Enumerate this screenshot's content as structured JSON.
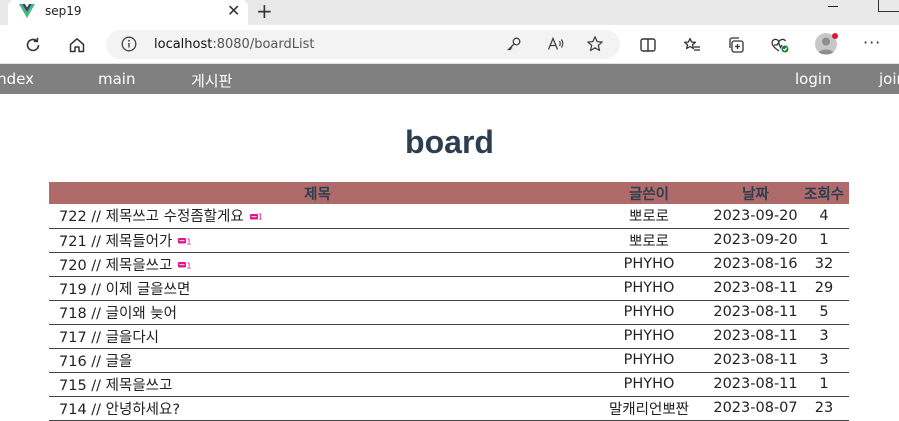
{
  "browser": {
    "tab_title": "sep19",
    "url_host": "localhost",
    "url_rest": ":8080/boardList",
    "accent": "#42b883"
  },
  "nav": {
    "index": "index",
    "main": "main",
    "board": "게시판",
    "login": "login",
    "join": "join"
  },
  "page": {
    "title": "board"
  },
  "table": {
    "headers": [
      "제목",
      "글쓴이",
      "날짜",
      "조회수"
    ],
    "header_color": "#af6a6a",
    "rows": [
      {
        "title": "722 // 제목쓰고 수정좀할게요",
        "comments": "1",
        "writer": "뽀로로",
        "date": "2023-09-20",
        "views": "4"
      },
      {
        "title": "721 // 제목들어가",
        "comments": "1",
        "writer": "뽀로로",
        "date": "2023-09-20",
        "views": "1"
      },
      {
        "title": "720 // 제목을쓰고",
        "comments": "1",
        "writer": "PHYHO",
        "date": "2023-08-16",
        "views": "32"
      },
      {
        "title": "719 // 이제 글을쓰면",
        "comments": "",
        "writer": "PHYHO",
        "date": "2023-08-11",
        "views": "29"
      },
      {
        "title": "718 // 글이왜 늦어",
        "comments": "",
        "writer": "PHYHO",
        "date": "2023-08-11",
        "views": "5"
      },
      {
        "title": "717 // 글을다시",
        "comments": "",
        "writer": "PHYHO",
        "date": "2023-08-11",
        "views": "3"
      },
      {
        "title": "716 // 글을",
        "comments": "",
        "writer": "PHYHO",
        "date": "2023-08-11",
        "views": "3"
      },
      {
        "title": "715 // 제목을쓰고",
        "comments": "",
        "writer": "PHYHO",
        "date": "2023-08-11",
        "views": "1"
      },
      {
        "title": "714 // 안녕하세요?",
        "comments": "",
        "writer": "말캐리언뽀짠",
        "date": "2023-08-07",
        "views": "23"
      }
    ]
  }
}
